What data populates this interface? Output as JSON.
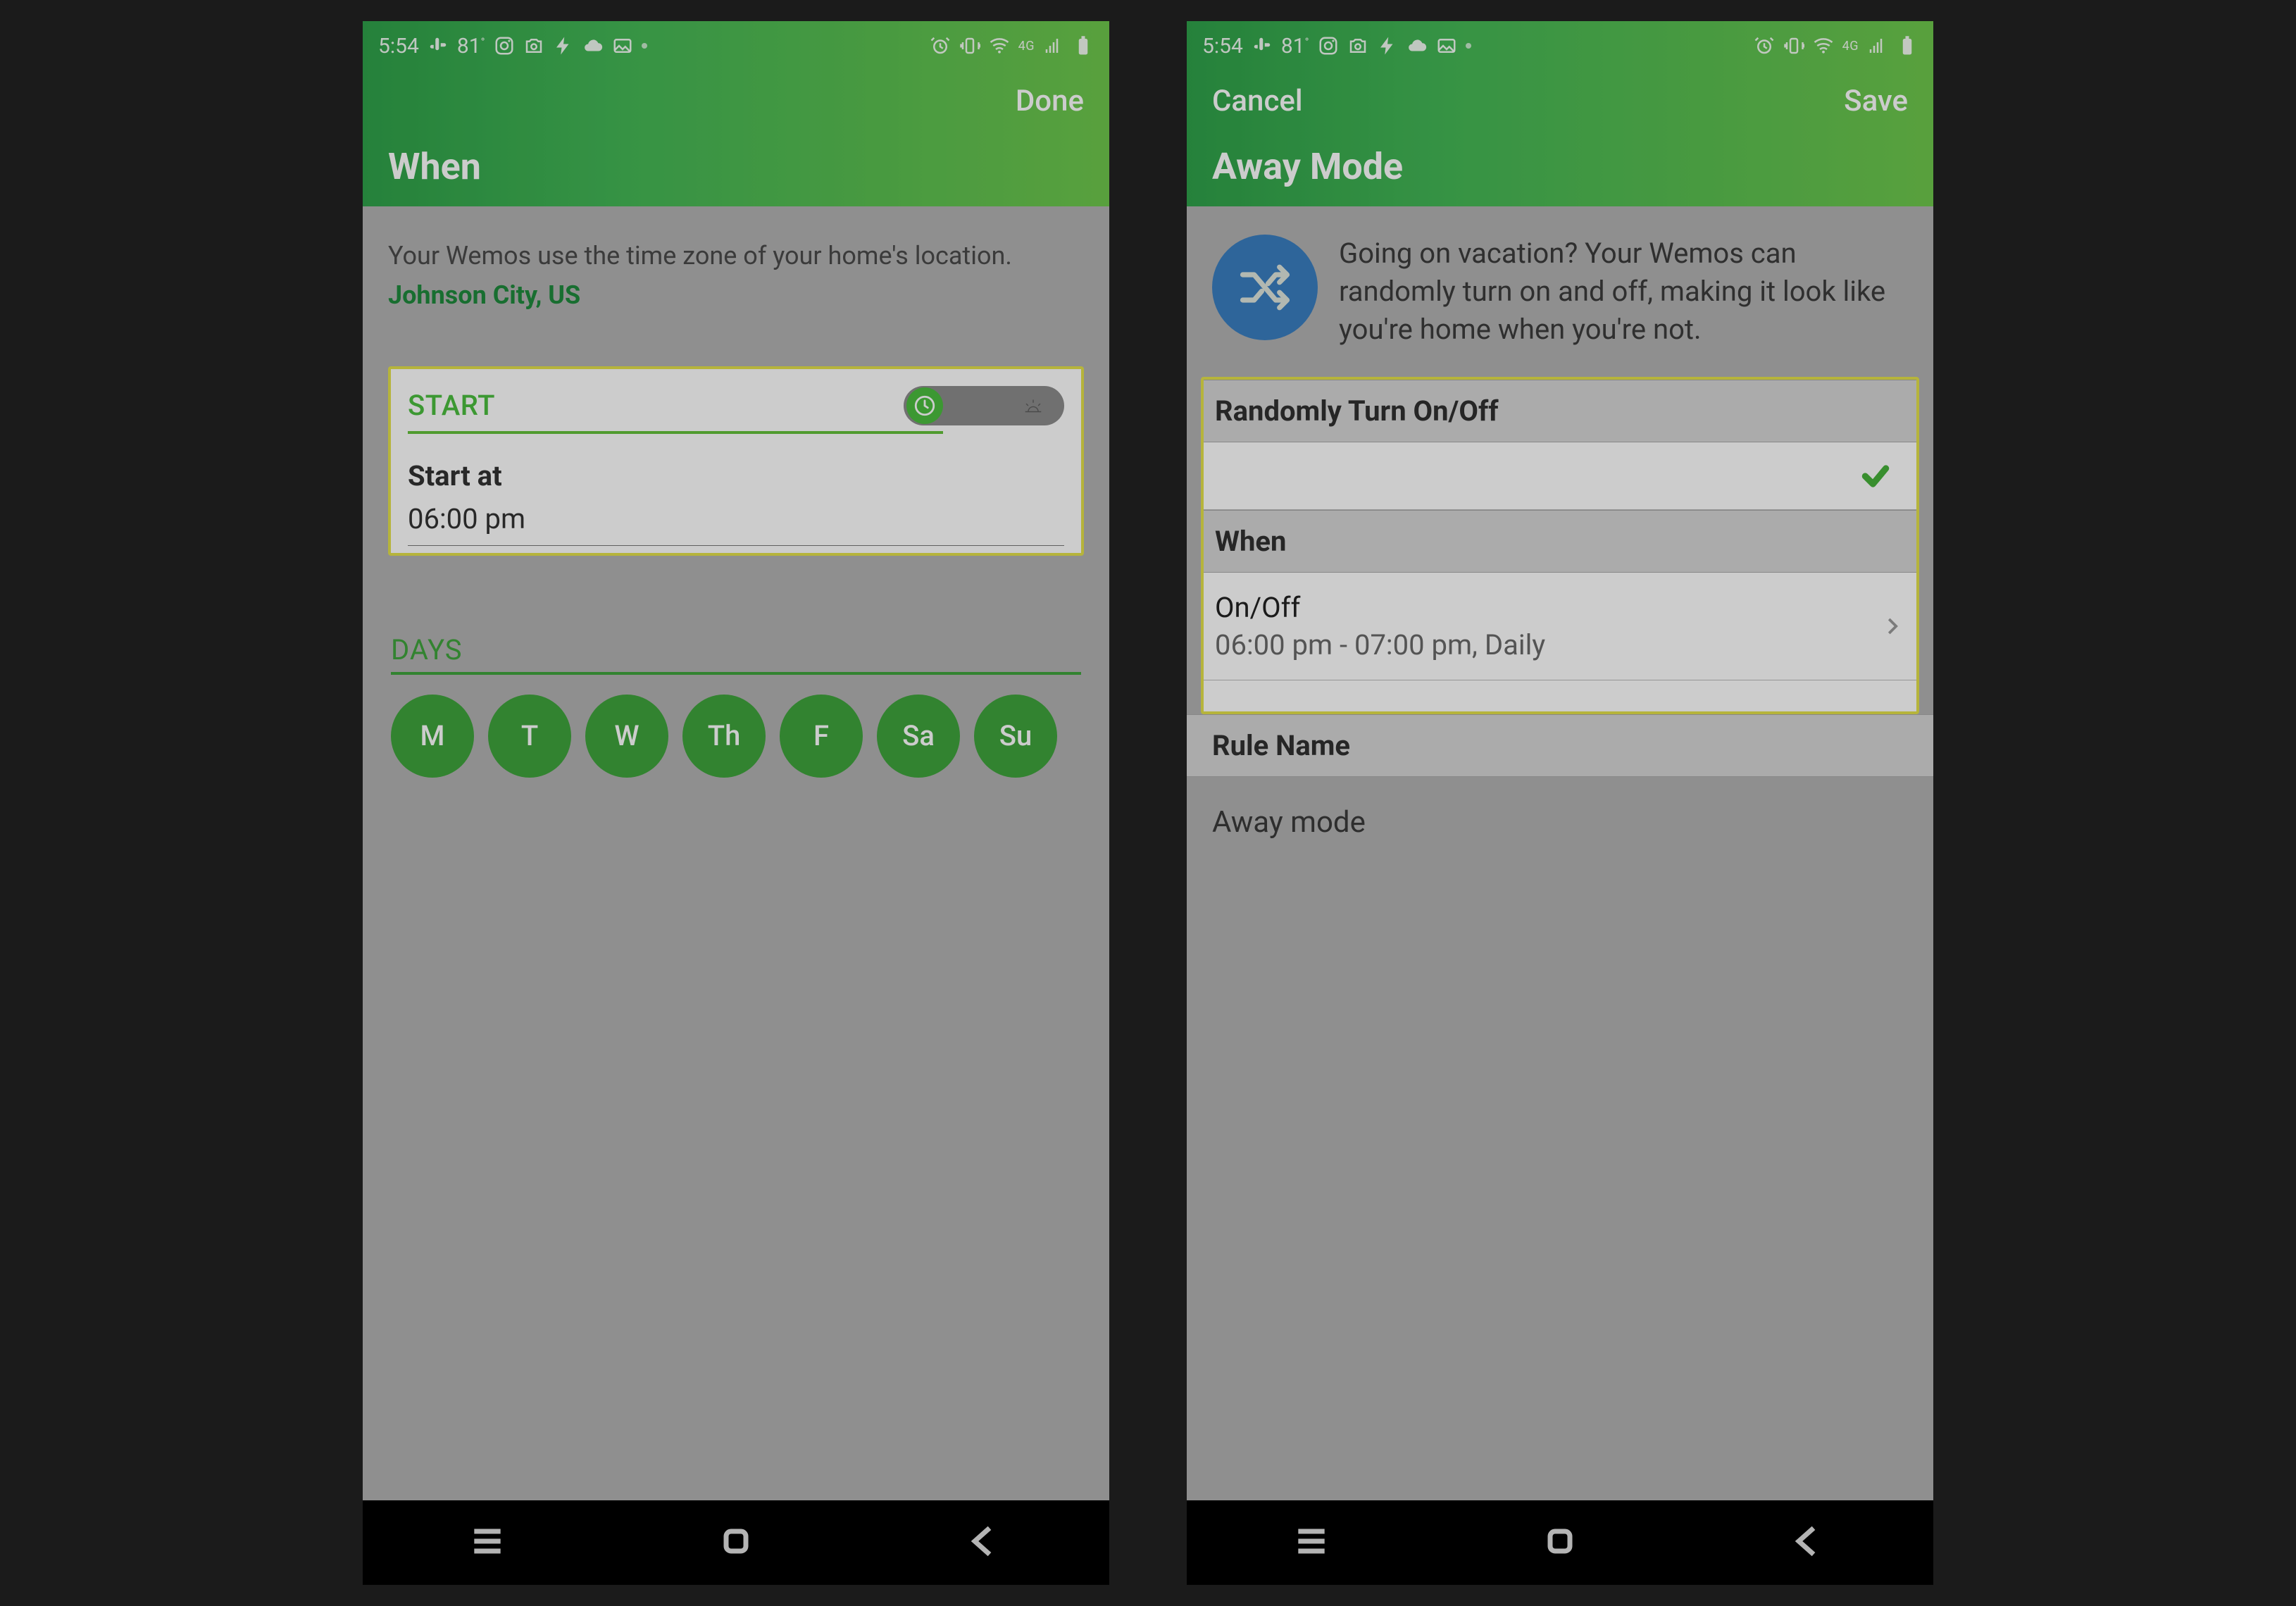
{
  "statusbar": {
    "time": "5:54",
    "temp": "81",
    "net_label": "4G"
  },
  "screen1": {
    "done": "Done",
    "title": "When",
    "desc": "Your Wemos use the time zone of your home's location.",
    "location": "Johnson City, US",
    "start_label": "START",
    "start_at_label": "Start at",
    "start_at_value": "06:00 pm",
    "days_label": "DAYS",
    "days": [
      "M",
      "T",
      "W",
      "Th",
      "F",
      "Sa",
      "Su"
    ]
  },
  "screen2": {
    "cancel": "Cancel",
    "save": "Save",
    "title": "Away Mode",
    "intro": "Going on vacation? Your Wemos can randomly turn on and off, making it look like you're home when you're not.",
    "section_random": "Randomly Turn On/Off",
    "section_when": "When",
    "onoff_label": "On/Off",
    "onoff_value": "06:00 pm - 07:00 pm, Daily",
    "section_rulename": "Rule Name",
    "rulename_value": "Away mode"
  }
}
